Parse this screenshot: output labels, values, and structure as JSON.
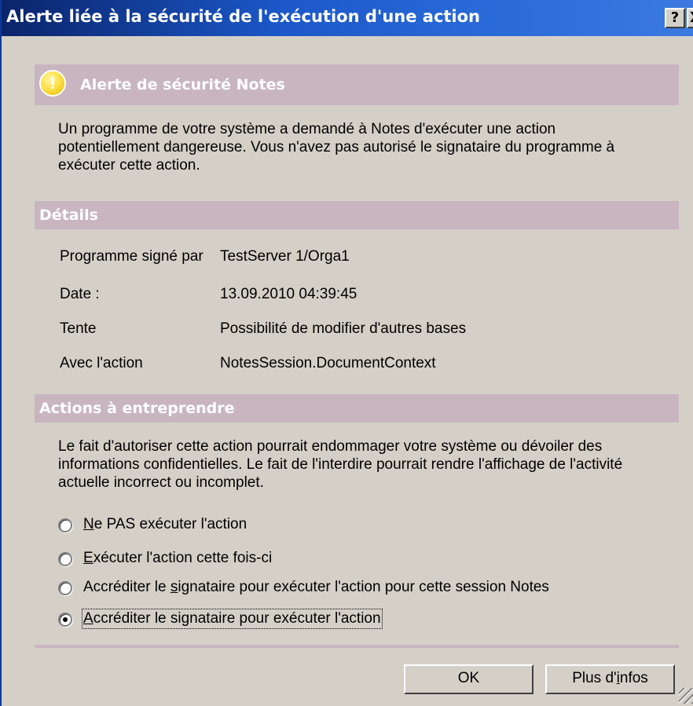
{
  "window": {
    "title": "Alerte liée à la sécurité de l'exécution d'une action",
    "help_glyph": "?",
    "close_glyph": "X"
  },
  "alert": {
    "heading": "Alerte de sécurité Notes",
    "icon": "exclamation-icon",
    "icon_glyph": "!",
    "message": "Un programme de votre système a demandé à Notes d'exécuter une action potentiellement dangereuse. Vous n'avez pas autorisé le signataire du programme à exécuter cette action."
  },
  "details": {
    "heading": "Détails",
    "rows": [
      {
        "label": "Programme signé par",
        "value": "TestServer 1/Orga1"
      },
      {
        "label": "Date :",
        "value": "13.09.2010 04:39:45"
      },
      {
        "label": "Tente",
        "value": "Possibilité de modifier d'autres bases"
      },
      {
        "label": "Avec l'action",
        "value": "NotesSession.DocumentContext"
      }
    ]
  },
  "actions": {
    "heading": "Actions à entreprendre",
    "warning": "Le fait d'autoriser cette action pourrait endommager votre système ou dévoiler des informations confidentielles. Le fait de l'interdire pourrait rendre l'affichage de l'activité actuelle incorrect ou incomplet.",
    "options": [
      {
        "pre": "",
        "key": "N",
        "post": "e PAS exécuter l'action",
        "checked": false
      },
      {
        "pre": "",
        "key": "E",
        "post": "xécuter l'action cette fois-ci",
        "checked": false
      },
      {
        "pre": "Accréditer le ",
        "key": "s",
        "post": "ignataire pour exécuter l'action pour cette session Notes",
        "checked": false
      },
      {
        "pre": "",
        "key": "A",
        "post": "ccréditer le signataire pour exécuter l'action",
        "checked": true
      }
    ]
  },
  "buttons": {
    "ok": "OK",
    "more_pre": "Plus d'",
    "more_key": "i",
    "more_post": "nfos"
  },
  "colors": {
    "titlebar": "#0a246a",
    "section_bar": "#c8b5c0",
    "dialog_bg": "#d4d0c8"
  }
}
